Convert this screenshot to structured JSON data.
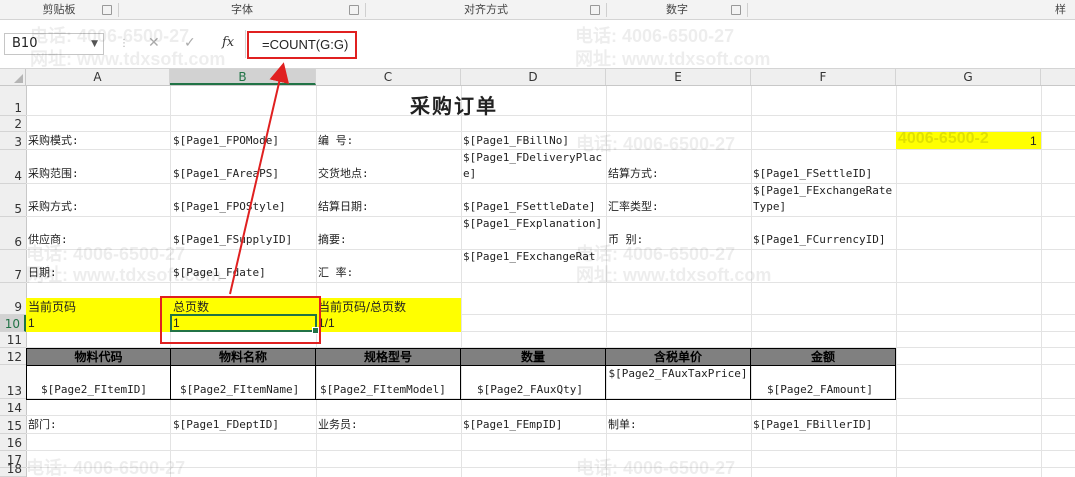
{
  "ribbon": {
    "groups": [
      "剪贴板",
      "字体",
      "对齐方式",
      "数字",
      "样"
    ]
  },
  "formula_bar": {
    "name_box": "B10",
    "formula": "=COUNT(G:G)",
    "fx_label": "fx"
  },
  "columns": [
    "A",
    "B",
    "C",
    "D",
    "E",
    "F",
    "G"
  ],
  "selected_column": "B",
  "rows": [
    "1",
    "2",
    "3",
    "4",
    "5",
    "6",
    "7",
    "9",
    "10",
    "11",
    "12",
    "13",
    "14",
    "15",
    "16",
    "17",
    "18"
  ],
  "selected_row": "10",
  "sheet": {
    "title": "采购订单",
    "r3": {
      "a": "采购模式:",
      "b": "$[Page1_FPOMode]",
      "c": "编    号:",
      "d": "$[Page1_FBillNo]",
      "g_text": "4006-6500-2",
      "g_value": "1"
    },
    "r4": {
      "a": "采购范围:",
      "b": "$[Page1_FAreaPS]",
      "c": "交货地点:",
      "d": "$[Page1_FDeliveryPlace]",
      "e": "结算方式:",
      "f": "$[Page1_FSettleID]"
    },
    "r5": {
      "a": "采购方式:",
      "b": "$[Page1_FPOStyle]",
      "c": "结算日期:",
      "d": "$[Page1_FSettleDate]",
      "e": "汇率类型:",
      "f": "$[Page1_FExchangeRateType]"
    },
    "r6": {
      "a": "供应商:",
      "b": "$[Page1_FSupplyID]",
      "c": "摘要:",
      "d": "$[Page1_FExplanation]",
      "e": "币    别:",
      "f": "$[Page1_FCurrencyID]"
    },
    "r7": {
      "a": "日期:",
      "b": "$[Page1_Fdate]",
      "c": "汇    率:",
      "d": "$[Page1_FExchangeRat"
    },
    "r9": {
      "a": "当前页码",
      "b": "总页数",
      "c": "当前页码/总页数"
    },
    "r10": {
      "a": "1",
      "b": "1",
      "c": "1/1"
    },
    "table_headers": [
      "物料代码",
      "物料名称",
      "规格型号",
      "数量",
      "含税单价",
      "金额"
    ],
    "table_row": [
      "$[Page2_FItemID]",
      "$[Page2_FItemName]",
      "$[Page2_FItemModel]",
      "$[Page2_FAuxQty]",
      "$[Page2_FAuxTaxPrice]",
      "$[Page2_FAmount]"
    ],
    "r15": {
      "a": "部门:",
      "b": "$[Page1_FDeptID]",
      "c": "业务员:",
      "d": "$[Page1_FEmpID]",
      "e": "制单:",
      "f": "$[Page1_FBillerID]"
    }
  },
  "watermark": {
    "phone": "电话: 4006-6500-27",
    "site": "网址: www.tdxsoft.com"
  },
  "colors": {
    "highlight": "#ffff00",
    "annotation": "#e02020",
    "selection": "#217346",
    "table_header": "#808080"
  }
}
